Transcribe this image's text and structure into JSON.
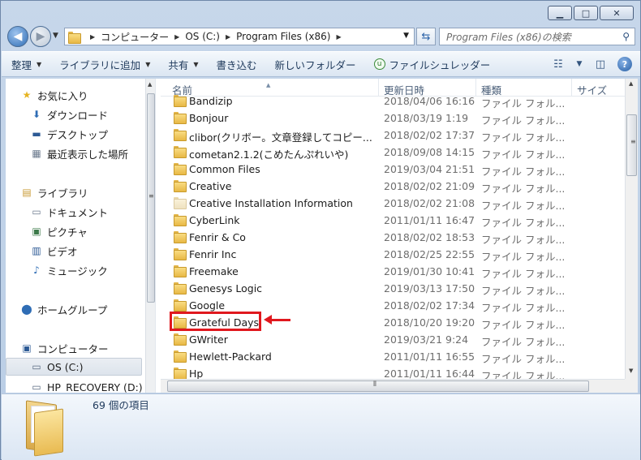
{
  "window": {
    "minimize": "▁",
    "maximize": "□",
    "close": "✕"
  },
  "address": {
    "crumbs": [
      "コンピューター",
      "OS (C:)",
      "Program Files (x86)"
    ],
    "search_placeholder": "Program Files (x86)の検索"
  },
  "toolbar": {
    "organize": "整理",
    "add_to_library": "ライブラリに追加",
    "share": "共有",
    "burn": "書き込む",
    "new_folder": "新しいフォルダー",
    "shredder": "ファイルシュレッダー"
  },
  "nav": {
    "favorites": "お気に入り",
    "downloads": "ダウンロード",
    "desktop": "デスクトップ",
    "recent": "最近表示した場所",
    "libraries": "ライブラリ",
    "documents": "ドキュメント",
    "pictures": "ピクチャ",
    "videos": "ビデオ",
    "music": "ミュージック",
    "homegroup": "ホームグループ",
    "computer": "コンピューター",
    "os_drive": "OS (C:)",
    "recovery_drive": "HP_RECOVERY (D:)"
  },
  "columns": {
    "name": "名前",
    "modified": "更新日時",
    "type": "種類",
    "size": "サイズ"
  },
  "files": [
    {
      "name": "Bandizip",
      "date": "2018/04/06 16:16",
      "type": "ファイル フォル..."
    },
    {
      "name": "Bonjour",
      "date": "2018/03/19 1:19",
      "type": "ファイル フォル..."
    },
    {
      "name": "clibor(クリボー。文章登録してコピー...",
      "date": "2018/02/02 17:37",
      "type": "ファイル フォル..."
    },
    {
      "name": "cometan2.1.2(こめたんぷれいや)",
      "date": "2018/09/08 14:15",
      "type": "ファイル フォル..."
    },
    {
      "name": "Common Files",
      "date": "2019/03/04 21:51",
      "type": "ファイル フォル..."
    },
    {
      "name": "Creative",
      "date": "2018/02/02 21:09",
      "type": "ファイル フォル..."
    },
    {
      "name": "Creative Installation Information",
      "date": "2018/02/02 21:08",
      "type": "ファイル フォル..."
    },
    {
      "name": "CyberLink",
      "date": "2011/01/11 16:47",
      "type": "ファイル フォル..."
    },
    {
      "name": "Fenrir & Co",
      "date": "2018/02/02 18:53",
      "type": "ファイル フォル..."
    },
    {
      "name": "Fenrir Inc",
      "date": "2018/02/25 22:55",
      "type": "ファイル フォル..."
    },
    {
      "name": "Freemake",
      "date": "2019/01/30 10:41",
      "type": "ファイル フォル..."
    },
    {
      "name": "Genesys Logic",
      "date": "2019/03/13 17:50",
      "type": "ファイル フォル..."
    },
    {
      "name": "Google",
      "date": "2018/02/02 17:34",
      "type": "ファイル フォル..."
    },
    {
      "name": "Grateful Days",
      "date": "2018/10/20 19:20",
      "type": "ファイル フォル..."
    },
    {
      "name": "GWriter",
      "date": "2019/03/21 9:24",
      "type": "ファイル フォル..."
    },
    {
      "name": "Hewlett-Packard",
      "date": "2011/01/11 16:55",
      "type": "ファイル フォル..."
    },
    {
      "name": "Hp",
      "date": "2011/01/11 16:44",
      "type": "ファイル フォル..."
    }
  ],
  "details": {
    "count": "69 個の項目"
  }
}
